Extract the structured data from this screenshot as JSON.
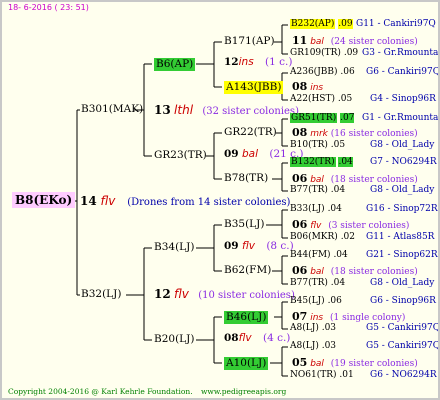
{
  "header": {
    "date": "18-  6-2016 ( 23: 51)"
  },
  "footer": {
    "copyright": "Copyright 2004-2016 @ Karl Kehrle Foundation.",
    "url": "www.pedigreeapis.org"
  },
  "root": {
    "label": "B8(EKo)",
    "num": "14",
    "abbr": "flv",
    "note": "(Drones from 14 sister colonies)"
  },
  "gen1": [
    {
      "label": "B301(MAK)",
      "num": "13",
      "abbr": "lthl",
      "note": "(32 sister colonies)"
    },
    {
      "label": "B32(LJ)",
      "num": "12",
      "abbr": "flv",
      "note": "(10 sister colonies)"
    }
  ],
  "gen2": [
    {
      "label": "B6(AP)",
      "num": "12",
      "abbr": "ins",
      "note": "(1 c.)"
    },
    {
      "label": "GR23(TR)",
      "num": "09",
      "abbr": "bal",
      "note": "(21 c.)"
    },
    {
      "label": "B34(LJ)",
      "num": "09",
      "abbr": "flv",
      "note": "(8 c.)"
    },
    {
      "label": "B20(LJ)",
      "num": "08",
      "abbr": "flv",
      "note": "(4 c.)"
    }
  ],
  "gen3": [
    {
      "label": "B171(AP)",
      "num": "11",
      "abbr": "bal",
      "note": "(24 sister colonies)"
    },
    {
      "label": "A143(JBB)",
      "num": "08",
      "abbr": "ins",
      "note": ""
    },
    {
      "label": "GR22(TR)",
      "num": "08",
      "abbr": "mrk",
      "note": "(16 sister colonies)"
    },
    {
      "label": "B78(TR)",
      "num": "06",
      "abbr": "bal",
      "note": "(18 sister colonies)"
    },
    {
      "label": "B35(LJ)",
      "num": "06",
      "abbr": "flv",
      "note": "(3 sister colonies)"
    },
    {
      "label": "B62(FM)",
      "num": "06",
      "abbr": "bal",
      "note": "(18 sister colonies)"
    },
    {
      "label": "B46(LJ)",
      "num": "07",
      "abbr": "ins",
      "note": "(1 single colony)"
    },
    {
      "label": "A10(LJ)",
      "num": "05",
      "abbr": "bal",
      "note": "(19 sister colonies)"
    }
  ],
  "gen4": [
    {
      "label": "B232(AP)",
      "val": ".09",
      "code": "G11 - Cankiri97Q"
    },
    {
      "label": "GR109(TR)",
      "val": ".09",
      "code": "G3 - Gr.Rmounta"
    },
    {
      "label": "A236(JBB)",
      "val": ".06",
      "code": "G6 - Cankiri97Q"
    },
    {
      "label": "A22(HST)",
      "val": ".05",
      "code": "G4 - Sinop96R"
    },
    {
      "label": "GR51(TR)",
      "val": ".07",
      "code": "G1 - Gr.Rmounta"
    },
    {
      "label": "B10(TR)",
      "val": ".05",
      "code": "G8 - Old_Lady"
    },
    {
      "label": "B132(TR)",
      "val": ".04",
      "code": "G7 - NO6294R"
    },
    {
      "label": "B77(TR)",
      "val": ".04",
      "code": "G8 - Old_Lady"
    },
    {
      "label": "B33(LJ)",
      "val": ".04",
      "code": "G16 - Sinop72R"
    },
    {
      "label": "B06(MKR)",
      "val": ".02",
      "code": "G11 - Atlas85R"
    },
    {
      "label": "B44(FM)",
      "val": ".04",
      "code": "G21 - Sinop62R"
    },
    {
      "label": "B77(TR)",
      "val": ".04",
      "code": "G8 - Old_Lady"
    },
    {
      "label": "B45(LJ)",
      "val": ".06",
      "code": "G6 - Sinop96R"
    },
    {
      "label": "A8(LJ)",
      "val": ".03",
      "code": "G5 - Cankiri97Q"
    },
    {
      "label": "A8(LJ)",
      "val": ".03",
      "code": "G5 - Cankiri97Q"
    },
    {
      "label": "NO61(TR)",
      "val": ".01",
      "code": "G6 - NO6294R"
    }
  ]
}
